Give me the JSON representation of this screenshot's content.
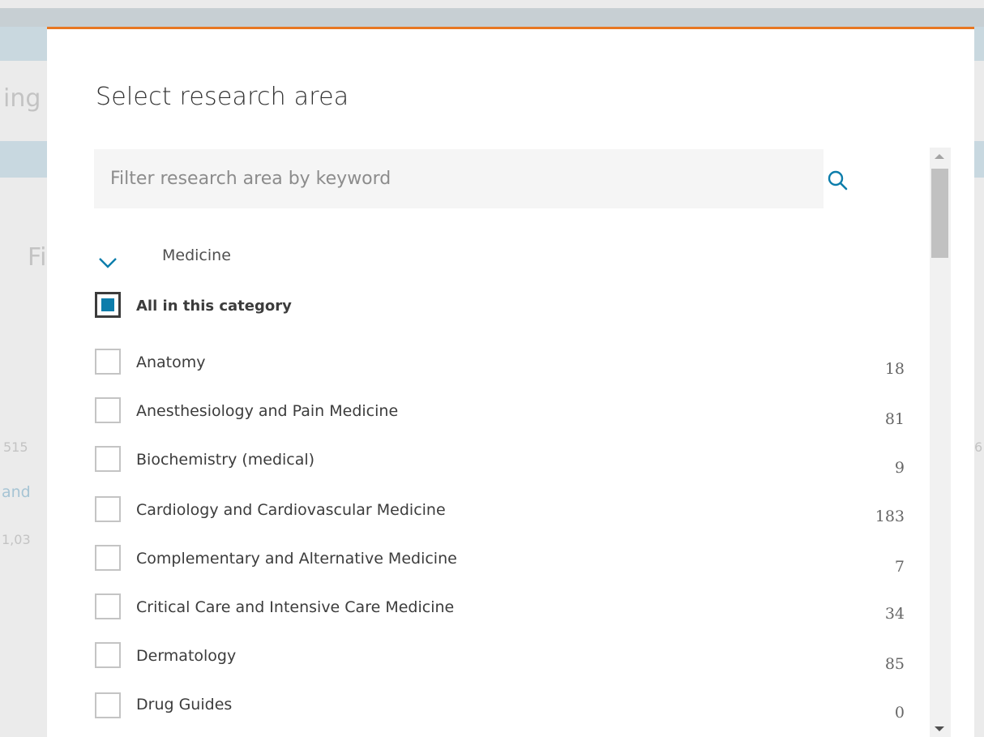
{
  "background": {
    "snippets": [
      "ing",
      "Fi",
      "515",
      "and",
      "1,03",
      "6"
    ]
  },
  "modal": {
    "title": "Select research area",
    "search": {
      "placeholder": "Filter research area by keyword"
    },
    "category": {
      "name": "Medicine",
      "all_label": "All in this category",
      "all_checked": true,
      "items": [
        {
          "label": "Anatomy",
          "count": "18"
        },
        {
          "label": "Anesthesiology and Pain Medicine",
          "count": "81"
        },
        {
          "label": "Biochemistry (medical)",
          "count": "9"
        },
        {
          "label": "Cardiology and Cardiovascular Medicine",
          "count": "183"
        },
        {
          "label": "Complementary and Alternative Medicine",
          "count": "7"
        },
        {
          "label": "Critical Care and Intensive Care Medicine",
          "count": "34"
        },
        {
          "label": "Dermatology",
          "count": "85"
        },
        {
          "label": "Drug Guides",
          "count": "0"
        }
      ]
    }
  },
  "colors": {
    "accent_orange": "#e87722",
    "primary_blue": "#0c7dab"
  },
  "icons": {
    "search": "search-icon",
    "chevron": "chevron-down-icon"
  }
}
